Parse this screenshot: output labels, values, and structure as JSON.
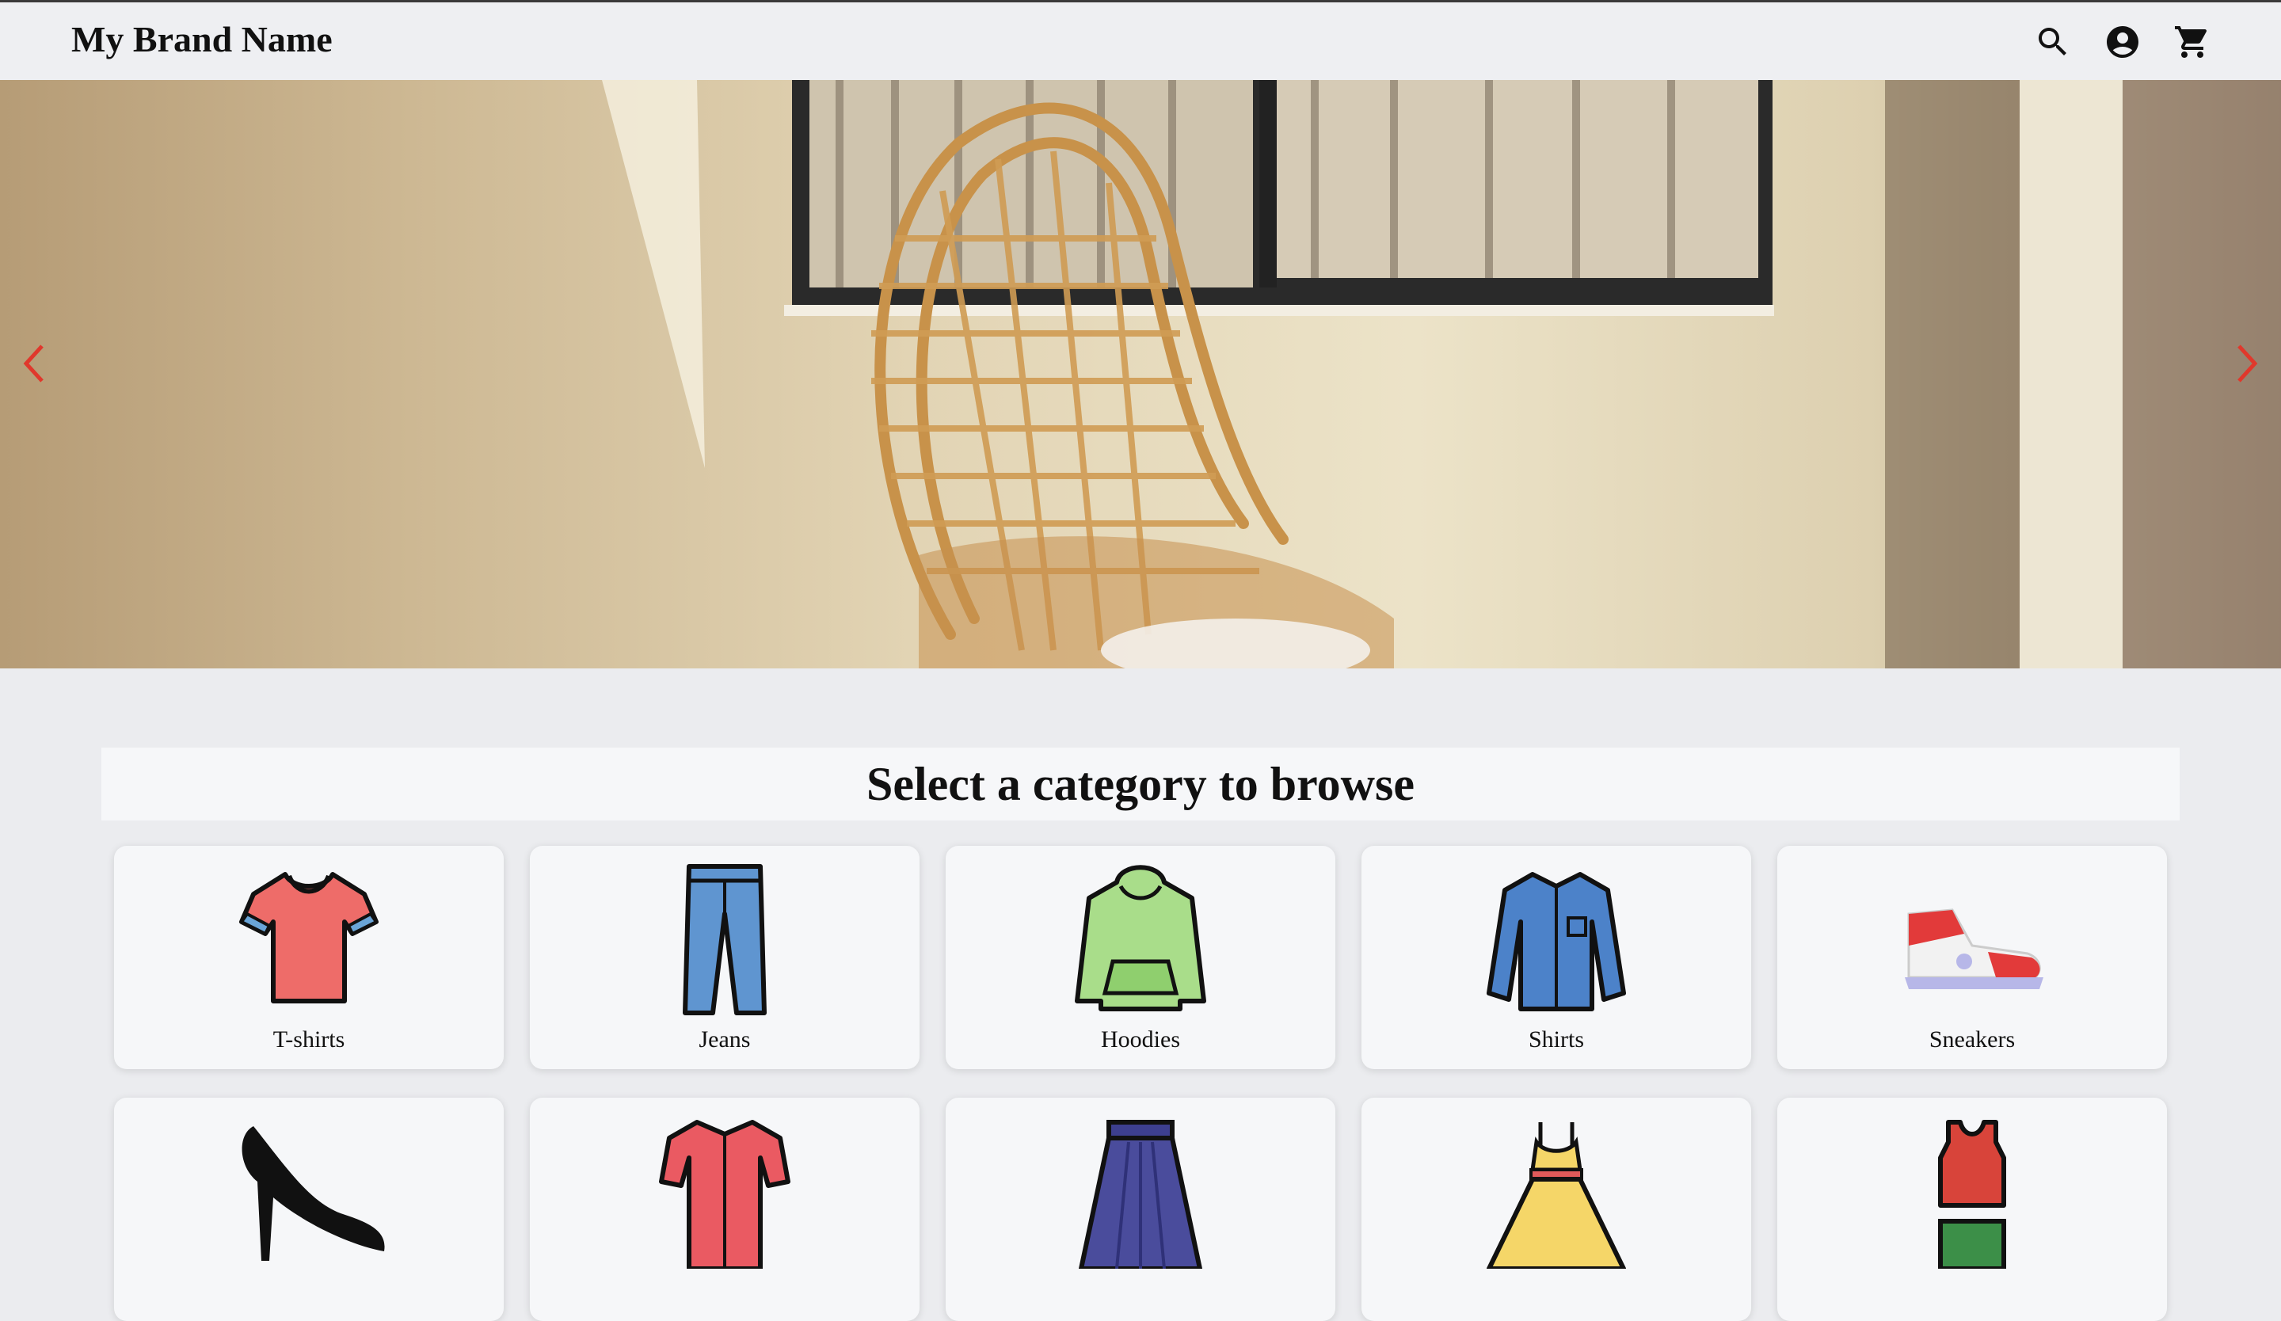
{
  "header": {
    "brand": "My Brand Name",
    "icons": [
      "search-icon",
      "account-icon",
      "cart-icon"
    ]
  },
  "hero": {
    "description_icons": [
      "chevron-left-icon",
      "chevron-right-icon"
    ],
    "accent_color": "#e0382c"
  },
  "categories": {
    "heading": "Select a category to browse",
    "items": [
      {
        "label": "T-shirts",
        "icon": "tshirt-icon"
      },
      {
        "label": "Jeans",
        "icon": "jeans-icon"
      },
      {
        "label": "Hoodies",
        "icon": "hoodie-icon"
      },
      {
        "label": "Shirts",
        "icon": "shirt-icon"
      },
      {
        "label": "Sneakers",
        "icon": "sneaker-icon"
      },
      {
        "label": "",
        "icon": "heels-icon"
      },
      {
        "label": "",
        "icon": "blouse-icon"
      },
      {
        "label": "",
        "icon": "skirt-icon"
      },
      {
        "label": "",
        "icon": "dress-icon"
      },
      {
        "label": "",
        "icon": "sportswear-icon"
      }
    ]
  }
}
